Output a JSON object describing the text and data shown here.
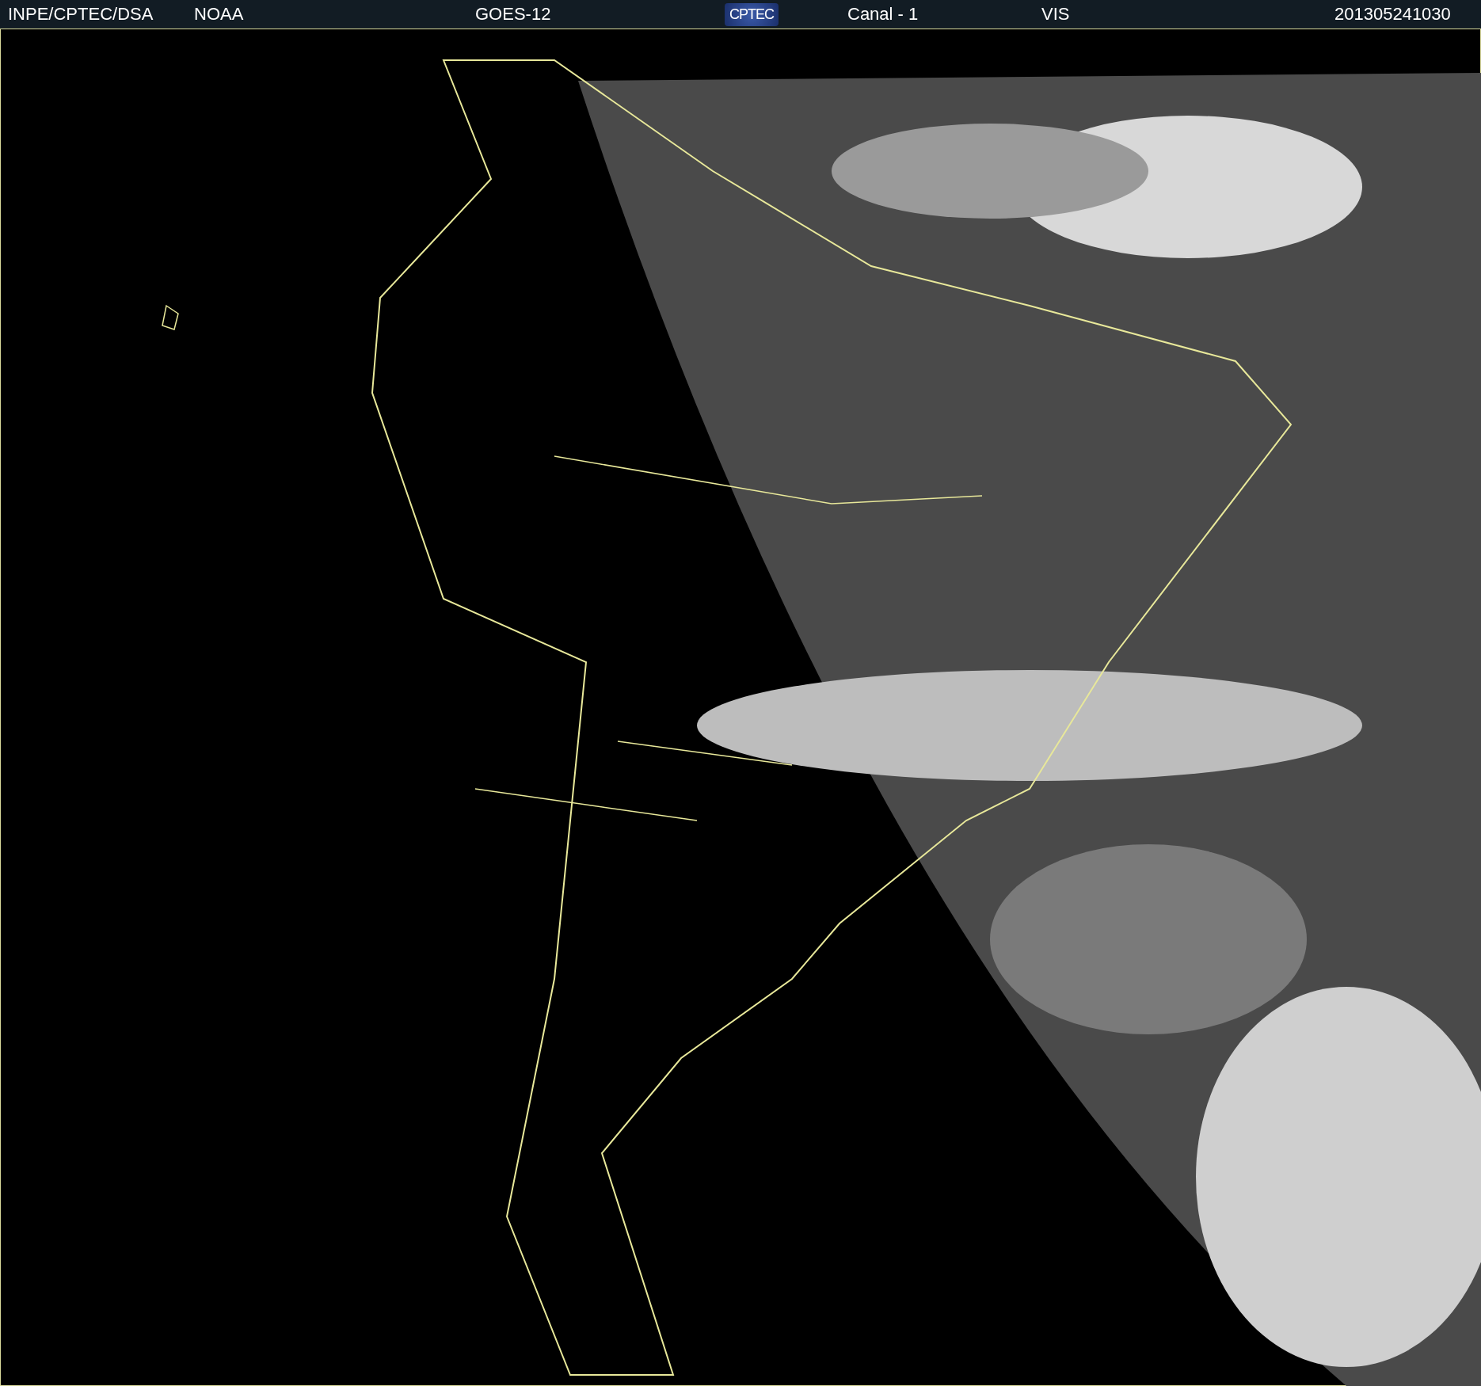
{
  "header": {
    "items": [
      {
        "kind": "text",
        "text": "INPE/CPTEC/DSA"
      },
      {
        "kind": "text",
        "text": "NOAA"
      },
      {
        "kind": "text",
        "text": "GOES-12"
      },
      {
        "kind": "logo",
        "text": "CPTEC"
      },
      {
        "kind": "text",
        "text": "Canal - 1"
      },
      {
        "kind": "text",
        "text": "VIS"
      },
      {
        "kind": "text",
        "text": "201305241030"
      }
    ]
  }
}
